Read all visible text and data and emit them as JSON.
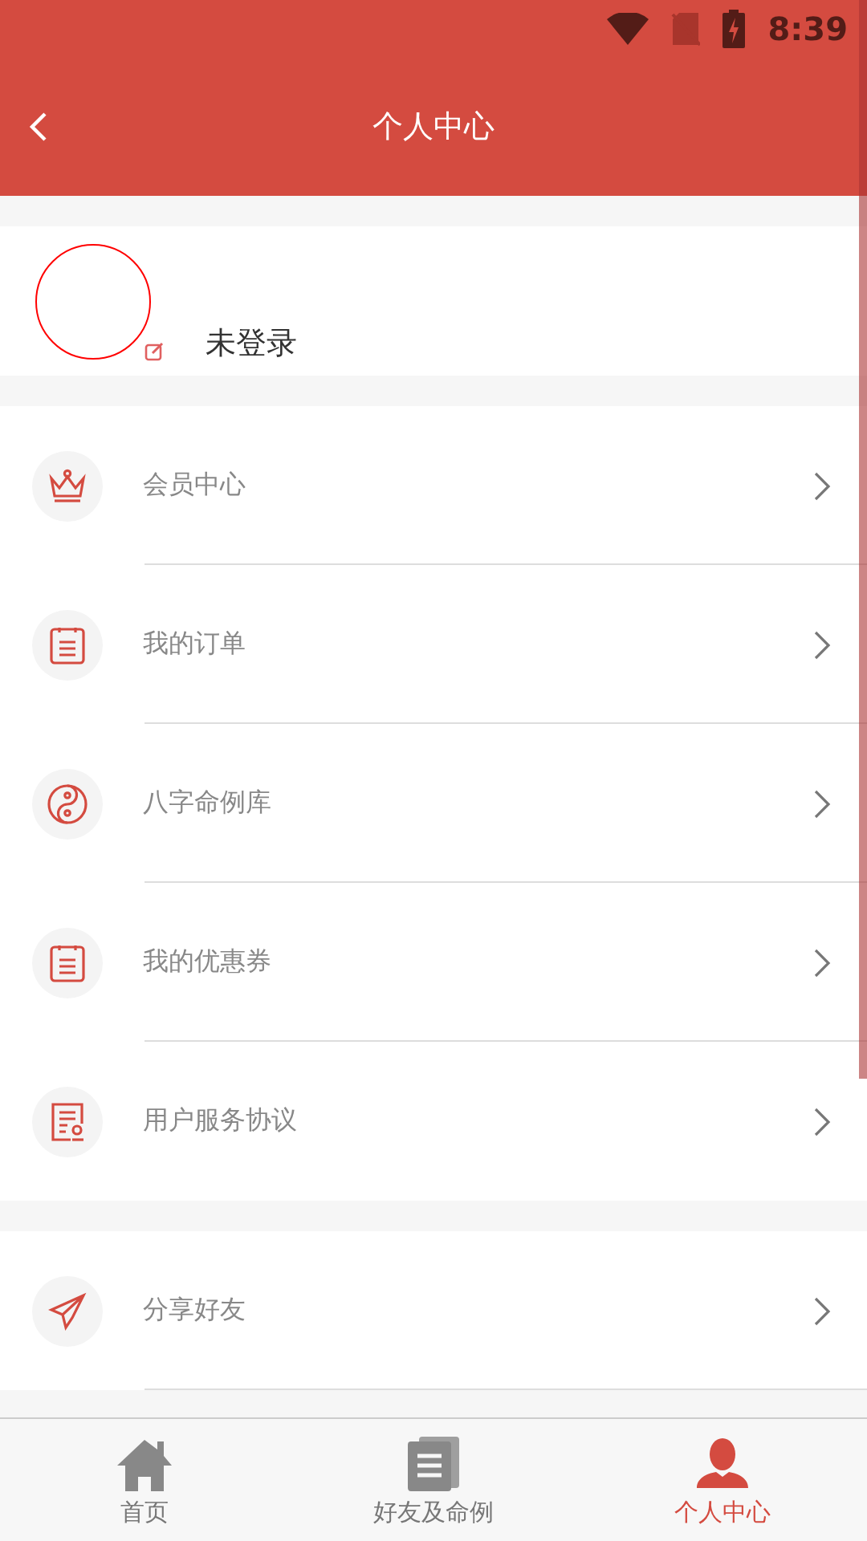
{
  "status_bar": {
    "time": "8:39"
  },
  "header": {
    "title": "个人中心"
  },
  "profile": {
    "name": "未登录"
  },
  "menu_groups": [
    {
      "items": [
        {
          "kind": "crown",
          "label": "会员中心"
        },
        {
          "kind": "clipboard",
          "label": "我的订单"
        },
        {
          "kind": "yinyang",
          "label": "八字命例库"
        },
        {
          "kind": "clipboard",
          "label": "我的优惠券"
        },
        {
          "kind": "certificate",
          "label": "用户服务协议"
        }
      ]
    },
    {
      "items": [
        {
          "kind": "plane",
          "label": "分享好友"
        }
      ]
    }
  ],
  "tab_bar": [
    {
      "kind": "home",
      "label": "首页",
      "selected": false
    },
    {
      "kind": "docs",
      "label": "好友及命例",
      "selected": false
    },
    {
      "kind": "person",
      "label": "个人中心",
      "selected": true
    }
  ]
}
